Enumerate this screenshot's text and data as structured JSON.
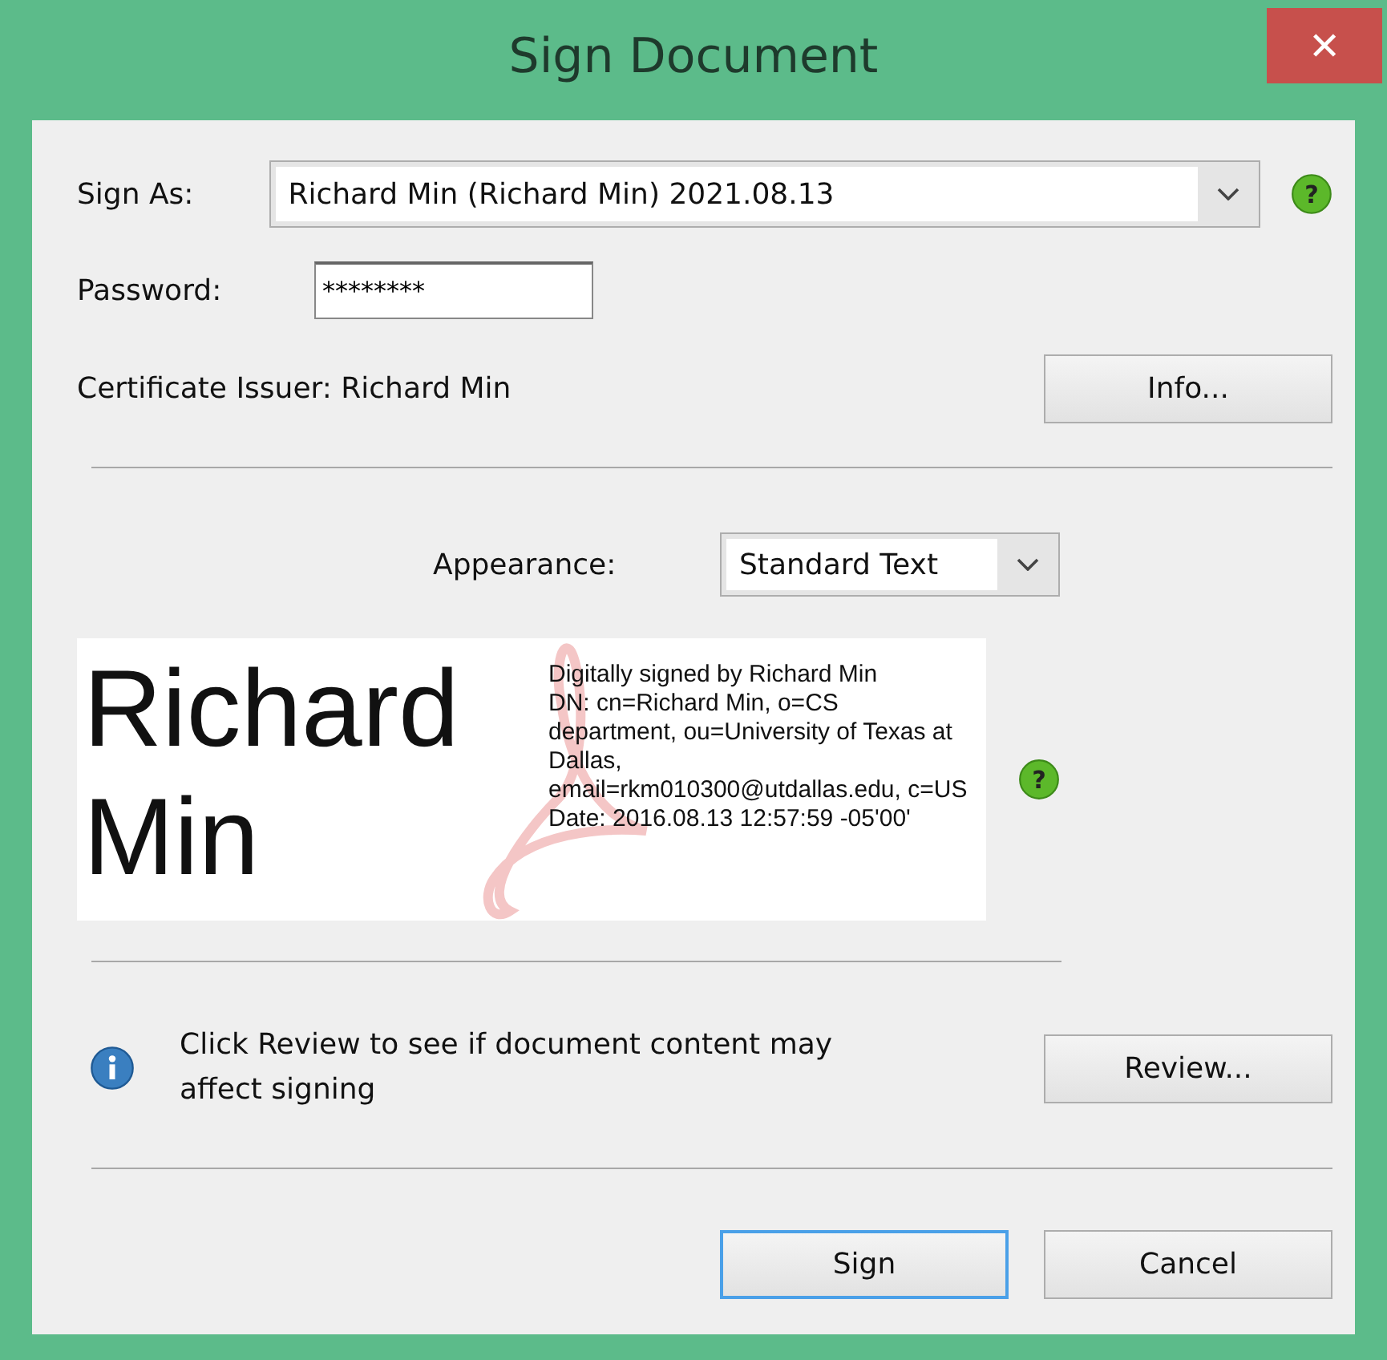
{
  "window": {
    "title": "Sign Document",
    "close": "✕"
  },
  "sign_as": {
    "label": "Sign As:",
    "value": "Richard Min (Richard Min) 2021.08.13",
    "help": "?"
  },
  "password": {
    "label": "Password:",
    "value": "********"
  },
  "certificate_issuer": "Certificate Issuer: Richard Min",
  "info_button": "Info...",
  "appearance": {
    "label": "Appearance:",
    "value": "Standard Text"
  },
  "preview": {
    "name": "Richard Min",
    "help": "?",
    "details": [
      "Digitally signed by Richard Min",
      "DN: cn=Richard Min, o=CS department, ou=University of Texas at Dallas, email=rkm010300@utdallas.edu, c=US",
      "Date: 2016.08.13 12:57:59 -05'00'"
    ]
  },
  "review_note": "Click Review to see if document content may affect signing",
  "review_button": "Review...",
  "buttons": [
    {
      "label": "Sign",
      "selected": true
    },
    {
      "label": "Cancel",
      "selected": false
    }
  ]
}
